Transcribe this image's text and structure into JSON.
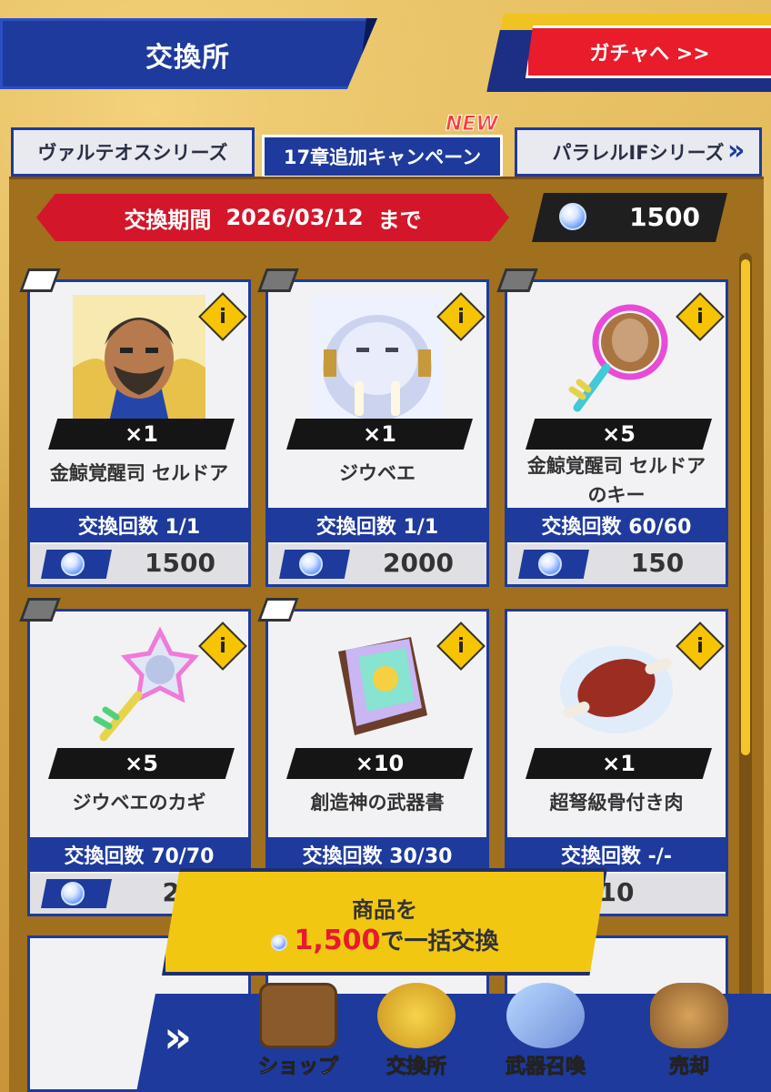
{
  "header": {
    "title": "交換所",
    "gacha_button": "ガチャへ >>"
  },
  "tabs": [
    {
      "label": "ヴァルテオスシリーズ",
      "active": false
    },
    {
      "label": "17章追加キャンペーン",
      "active": true,
      "badge": "NEW"
    },
    {
      "label": "パラレルIFシリーズ",
      "active": false
    }
  ],
  "tab_next": "»",
  "period": {
    "label": "交換期間",
    "date": "2026/03/12",
    "suffix": "まで"
  },
  "balance": {
    "amount": "1500",
    "currency_icon": "gem-icon"
  },
  "items": [
    {
      "qty": "×1",
      "name": "金鯨覚醒司 セルドア",
      "count": "交換回数 1/1",
      "price": "1500",
      "art": "hero-portrait"
    },
    {
      "qty": "×1",
      "name": "ジウベエ",
      "count": "交換回数 1/1",
      "price": "2000",
      "art": "walrus-portrait"
    },
    {
      "qty": "×5",
      "name": "金鯨覚醒司 セルドア\nのキー",
      "count": "交換回数 60/60",
      "price": "150",
      "art": "mirror-key"
    },
    {
      "qty": "×5",
      "name": "ジウベエのカギ",
      "count": "交換回数 70/70",
      "price": "20",
      "art": "star-key"
    },
    {
      "qty": "×10",
      "name": "創造神の武器書",
      "count": "交換回数 30/30",
      "price": "",
      "art": "book"
    },
    {
      "qty": "×1",
      "name": "超弩級骨付き肉",
      "count": "交換回数 -/-",
      "price": "10",
      "art": "meat"
    }
  ],
  "bulk_exchange": {
    "line1": "商品を",
    "amount": "1,500",
    "line2_suffix": "で一括交換"
  },
  "nav": [
    {
      "label": "ショップ",
      "icon": "shop-icon"
    },
    {
      "label": "交換所",
      "icon": "exchange-icon"
    },
    {
      "label": "武器召喚",
      "icon": "weapon-summon-icon"
    },
    {
      "label": "売却",
      "icon": "sell-icon"
    }
  ],
  "colors": {
    "primary_blue": "#1e3a9c",
    "red": "#d4162a",
    "gold": "#f2c712",
    "background": "#d6a94a"
  }
}
